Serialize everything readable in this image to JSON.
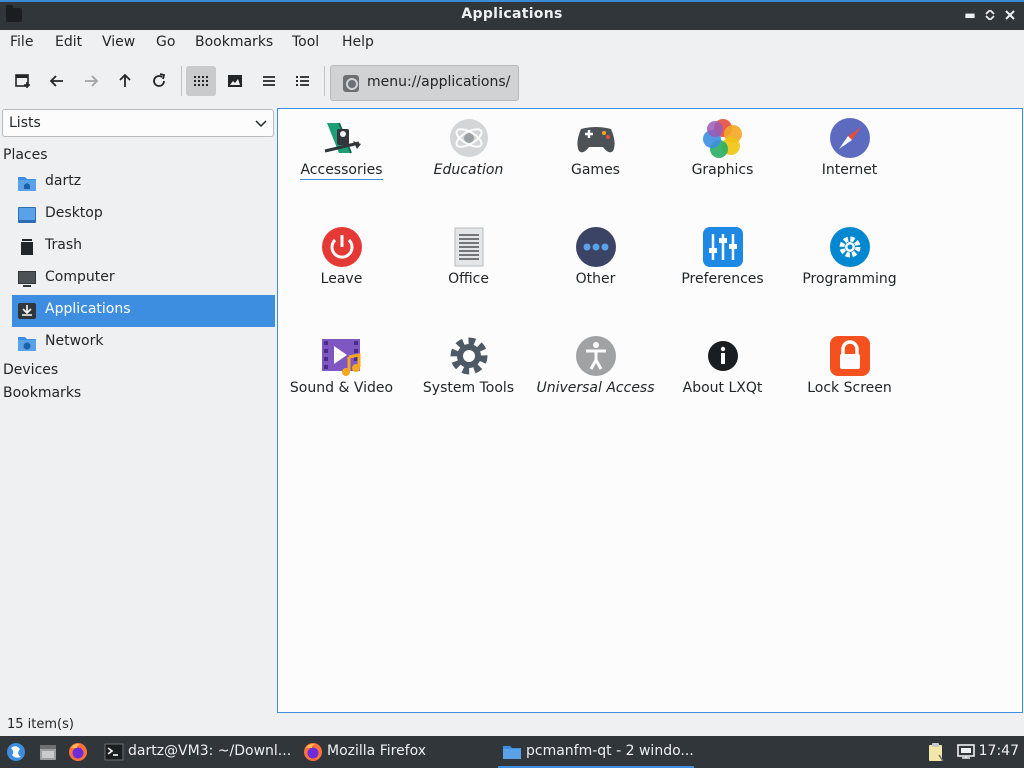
{
  "window": {
    "title": "Applications"
  },
  "menubar": {
    "items": [
      "File",
      "Edit",
      "View",
      "Go",
      "Bookmarks",
      "Tool",
      "Help"
    ]
  },
  "toolbar": {
    "buttons": [
      "new-tab",
      "back",
      "forward",
      "up",
      "reload",
      "icon-view",
      "thumbnail-view",
      "compact-view",
      "detailed-list-view"
    ],
    "active_view": "icon-view"
  },
  "address": {
    "path": "menu://applications/"
  },
  "sidepanel": {
    "mode": "Lists",
    "sections": {
      "places": "Places",
      "devices": "Devices",
      "bookmarks": "Bookmarks"
    },
    "places": [
      {
        "label": "dartz",
        "icon": "home-folder-icon"
      },
      {
        "label": "Desktop",
        "icon": "desktop-icon"
      },
      {
        "label": "Trash",
        "icon": "trash-icon"
      },
      {
        "label": "Computer",
        "icon": "computer-icon"
      },
      {
        "label": "Applications",
        "icon": "applications-icon",
        "selected": true
      },
      {
        "label": "Network",
        "icon": "network-folder-icon"
      }
    ]
  },
  "apps": [
    {
      "label": "Accessories",
      "icon": "accessories-icon"
    },
    {
      "label": "Education",
      "icon": "education-icon"
    },
    {
      "label": "Games",
      "icon": "games-icon"
    },
    {
      "label": "Graphics",
      "icon": "graphics-icon"
    },
    {
      "label": "Internet",
      "icon": "internet-icon"
    },
    {
      "label": "Leave",
      "icon": "leave-icon"
    },
    {
      "label": "Office",
      "icon": "office-icon"
    },
    {
      "label": "Other",
      "icon": "other-icon"
    },
    {
      "label": "Preferences",
      "icon": "preferences-icon"
    },
    {
      "label": "Programming",
      "icon": "programming-icon"
    },
    {
      "label": "Sound & Video",
      "icon": "sound-video-icon"
    },
    {
      "label": "System Tools",
      "icon": "system-tools-icon"
    },
    {
      "label": "Universal Access",
      "icon": "universal-access-icon"
    },
    {
      "label": "About LXQt",
      "icon": "about-icon"
    },
    {
      "label": "Lock Screen",
      "icon": "lock-screen-icon"
    }
  ],
  "status": {
    "text": "15 item(s)"
  },
  "taskbar": {
    "tasks": [
      {
        "label": "dartz@VM3: ~/Downl...",
        "icon": "terminal-icon"
      },
      {
        "label": "Mozilla Firefox",
        "icon": "firefox-icon"
      },
      {
        "label": "pcmanfm-qt - 2 windo...",
        "icon": "folder-icon",
        "active": true
      }
    ],
    "clock": "17:47"
  },
  "colors": {
    "accent": "#3d8ee0",
    "titlebar": "#31363b",
    "background": "#eff0f1"
  }
}
